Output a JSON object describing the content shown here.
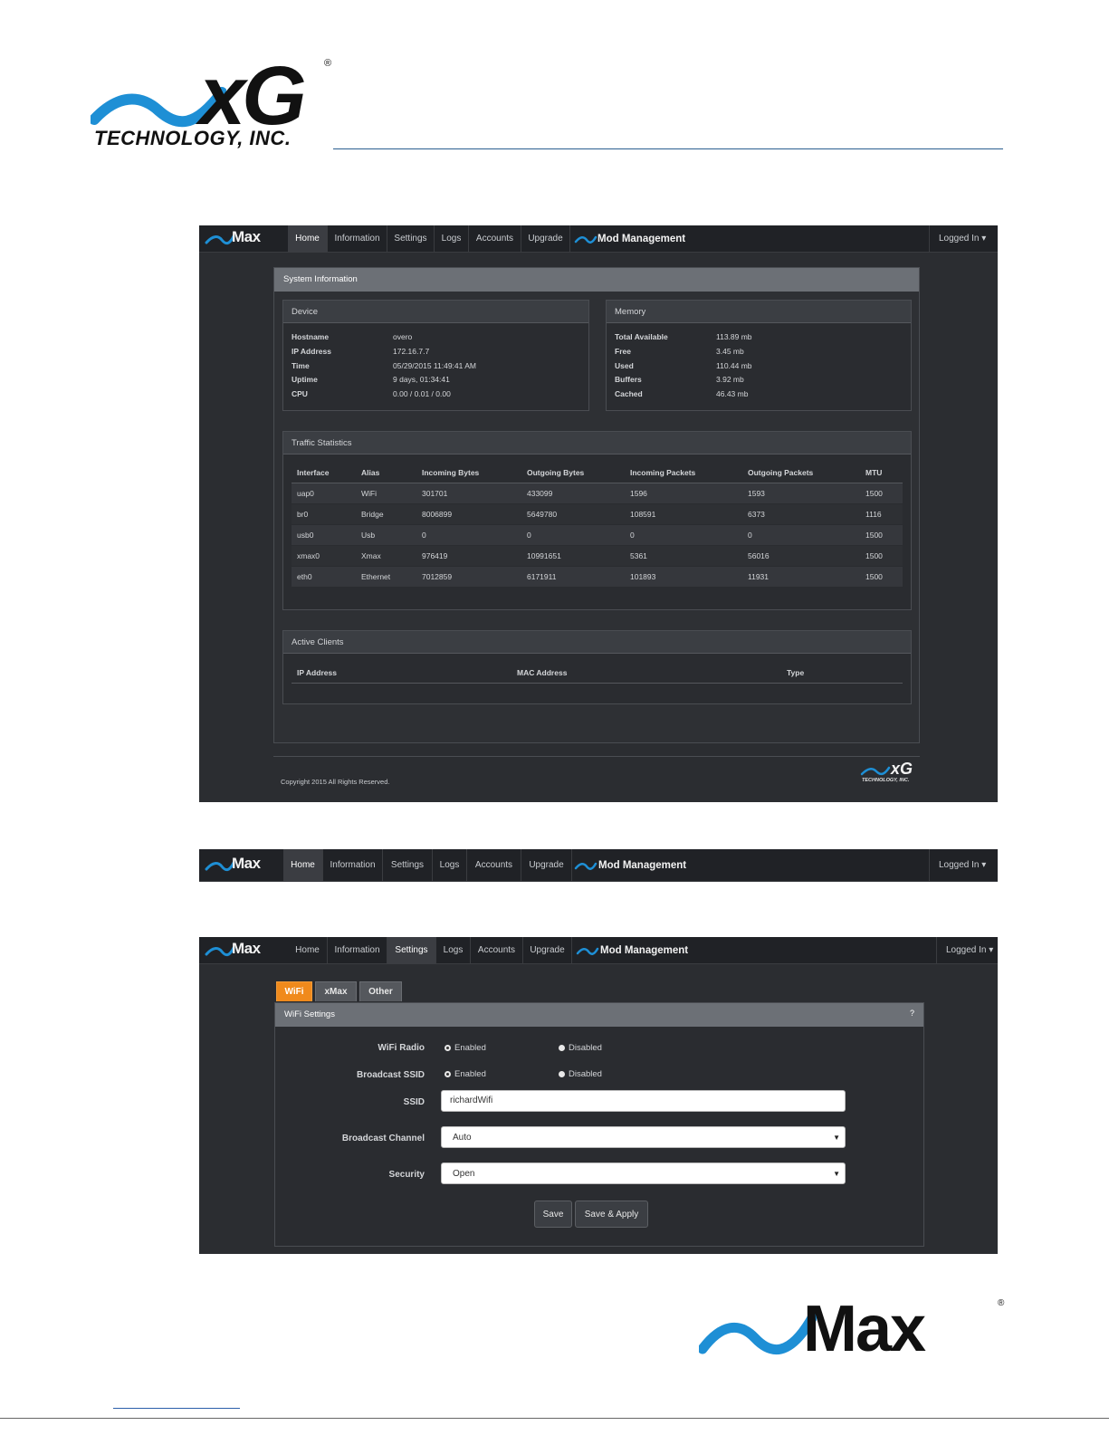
{
  "doc": {
    "logo_text": "xG",
    "logo_reg": "®",
    "logo_subtitle": "TECHNOLOGY, INC.",
    "bottom_brand": "Max",
    "bottom_brand_reg": "®"
  },
  "nav": {
    "brand": "Max",
    "tabs": [
      "Home",
      "Information",
      "Settings",
      "Logs",
      "Accounts",
      "Upgrade"
    ],
    "mod_management": "Mod Management",
    "logged_in": "Logged In ▾"
  },
  "system_info": {
    "title": "System Information",
    "device": {
      "title": "Device",
      "rows": [
        {
          "label": "Hostname",
          "value": "overo"
        },
        {
          "label": "IP Address",
          "value": "172.16.7.7"
        },
        {
          "label": "Time",
          "value": "05/29/2015 11:49:41 AM"
        },
        {
          "label": "Uptime",
          "value": "9 days, 01:34:41"
        },
        {
          "label": "CPU",
          "value": "0.00 / 0.01 / 0.00"
        }
      ]
    },
    "memory": {
      "title": "Memory",
      "rows": [
        {
          "label": "Total Available",
          "value": "113.89 mb"
        },
        {
          "label": "Free",
          "value": "3.45 mb"
        },
        {
          "label": "Used",
          "value": "110.44 mb"
        },
        {
          "label": "Buffers",
          "value": "3.92 mb"
        },
        {
          "label": "Cached",
          "value": "46.43 mb"
        }
      ]
    },
    "traffic": {
      "title": "Traffic Statistics",
      "headers": [
        "Interface",
        "Alias",
        "Incoming Bytes",
        "Outgoing Bytes",
        "Incoming Packets",
        "Outgoing Packets",
        "MTU"
      ],
      "rows": [
        [
          "uap0",
          "WiFi",
          "301701",
          "433099",
          "1596",
          "1593",
          "1500"
        ],
        [
          "br0",
          "Bridge",
          "8006899",
          "5649780",
          "108591",
          "6373",
          "1116"
        ],
        [
          "usb0",
          "Usb",
          "0",
          "0",
          "0",
          "0",
          "1500"
        ],
        [
          "xmax0",
          "Xmax",
          "976419",
          "10991651",
          "5361",
          "56016",
          "1500"
        ],
        [
          "eth0",
          "Ethernet",
          "7012859",
          "6171911",
          "101893",
          "11931",
          "1500"
        ]
      ]
    },
    "clients": {
      "title": "Active Clients",
      "headers": [
        "IP Address",
        "MAC Address",
        "Type"
      ]
    },
    "copyright": "Copyright 2015 All Rights Reserved.",
    "footer_logo": "xG",
    "footer_logo_sub": "TECHNOLOGY, INC."
  },
  "settings": {
    "subtabs": [
      "WiFi",
      "xMax",
      "Other"
    ],
    "title": "WiFi Settings",
    "help": "?",
    "wifi_radio_label": "WiFi Radio",
    "broadcast_ssid_label": "Broadcast SSID",
    "enabled": "Enabled",
    "disabled": "Disabled",
    "ssid_label": "SSID",
    "ssid_value": "richardWifi",
    "channel_label": "Broadcast Channel",
    "channel_value": "Auto",
    "security_label": "Security",
    "security_value": "Open",
    "save": "Save",
    "save_apply": "Save & Apply"
  },
  "colors": {
    "accent_orange": "#f08a1c",
    "brand_blue": "#1e8fd5",
    "nav_bg": "#202226"
  }
}
